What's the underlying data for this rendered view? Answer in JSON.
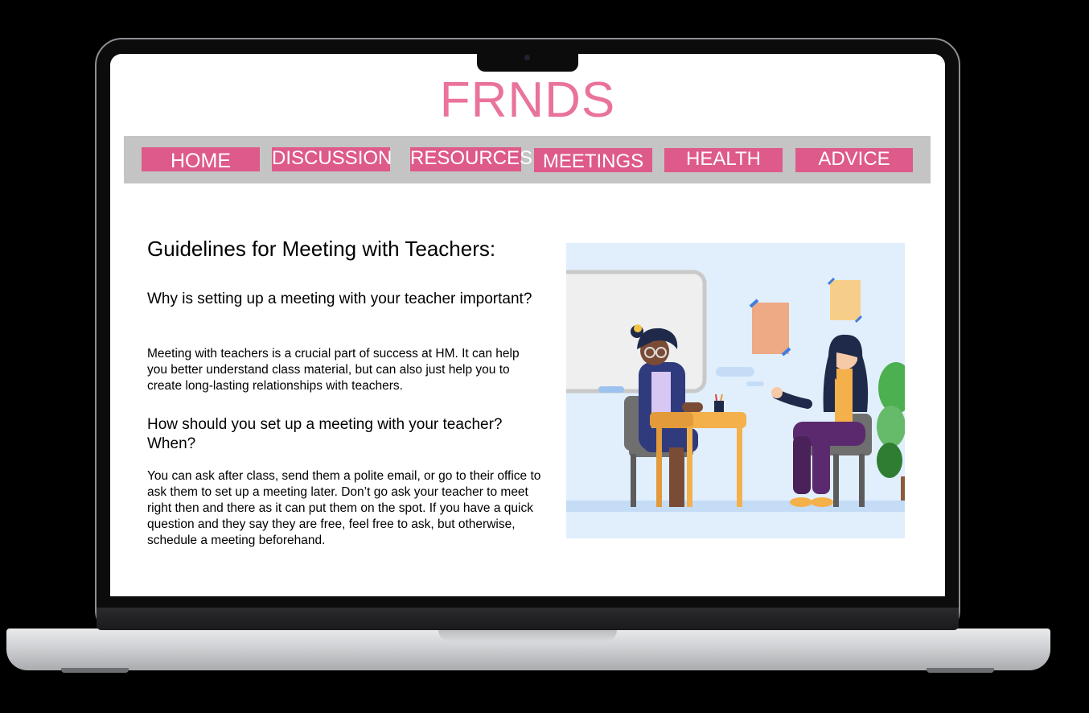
{
  "site": {
    "logo": "FRNDS",
    "brand_pink": "#e9739c",
    "nav_pink": "#de5a8a",
    "nav_bar_gray": "#c4c4c4"
  },
  "nav": {
    "items": [
      {
        "label": "HOME"
      },
      {
        "label": "DISCUSSION"
      },
      {
        "label": "RESOURCES"
      },
      {
        "label": "MEETINGS"
      },
      {
        "label": "HEALTH"
      },
      {
        "label": "ADVICE"
      }
    ]
  },
  "article": {
    "title": "Guidelines for Meeting with Teachers:",
    "sections": [
      {
        "heading": "Why is setting up a meeting with your teacher important?",
        "body": "Meeting with teachers is a crucial part of success at HM. It can help you better understand class material, but can also just help you to create long-lasting relationships with teachers."
      },
      {
        "heading": "How should you set up a meeting with your teacher? When?",
        "body": "You can ask after class, send them a polite email, or go to their office to ask them to set up a meeting later. Don’t go ask your teacher to meet right then and there as it can put them on the spot. If you have a quick question and they say they are free, feel free to ask, but otherwise, schedule a meeting beforehand."
      }
    ]
  },
  "illustration": {
    "icon": "student-teacher-meeting-illustration"
  }
}
